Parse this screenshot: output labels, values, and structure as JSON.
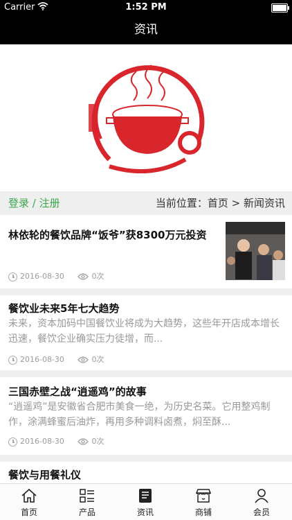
{
  "status": {
    "carrier": "Carrier",
    "time": "1:52 PM"
  },
  "nav": {
    "title": "资讯"
  },
  "crumb": {
    "login": "登录 / 注册",
    "location": "当前位置：首页 > 新闻资讯"
  },
  "articles": [
    {
      "title": "林依轮的餐饮品牌“饭爷”获8300万元投资",
      "summary": "",
      "date": "2016-08-30",
      "views": "0次"
    },
    {
      "title": "餐饮业未来5年七大趋势",
      "summary": "未来，资本加码中国餐饮业将成为大趋势，这些年开店成本增长迅速，餐饮企业确实压力徒增，而...",
      "date": "2016-08-30",
      "views": "0次"
    },
    {
      "title": "三国赤壁之战“逍遥鸡”的故事",
      "summary": "“逍遥鸡”是安徽省合肥市美食一绝，为历史名菜。它用整鸡制作，涂满蜂蜜后油炸，再用多种调料卤煮，焖至酥...",
      "date": "2016-08-30",
      "views": "0次"
    },
    {
      "title": "餐饮与用餐礼仪",
      "summary": "",
      "date": "",
      "views": ""
    }
  ],
  "tabs": [
    {
      "label": "首页",
      "icon": "home-icon"
    },
    {
      "label": "产品",
      "icon": "grid-list-icon"
    },
    {
      "label": "资讯",
      "icon": "news-icon"
    },
    {
      "label": "商铺",
      "icon": "store-icon"
    },
    {
      "label": "会员",
      "icon": "person-icon"
    }
  ],
  "colors": {
    "accent_green": "#3aa84a",
    "logo_red": "#d8262c",
    "bar_black": "#000000"
  }
}
